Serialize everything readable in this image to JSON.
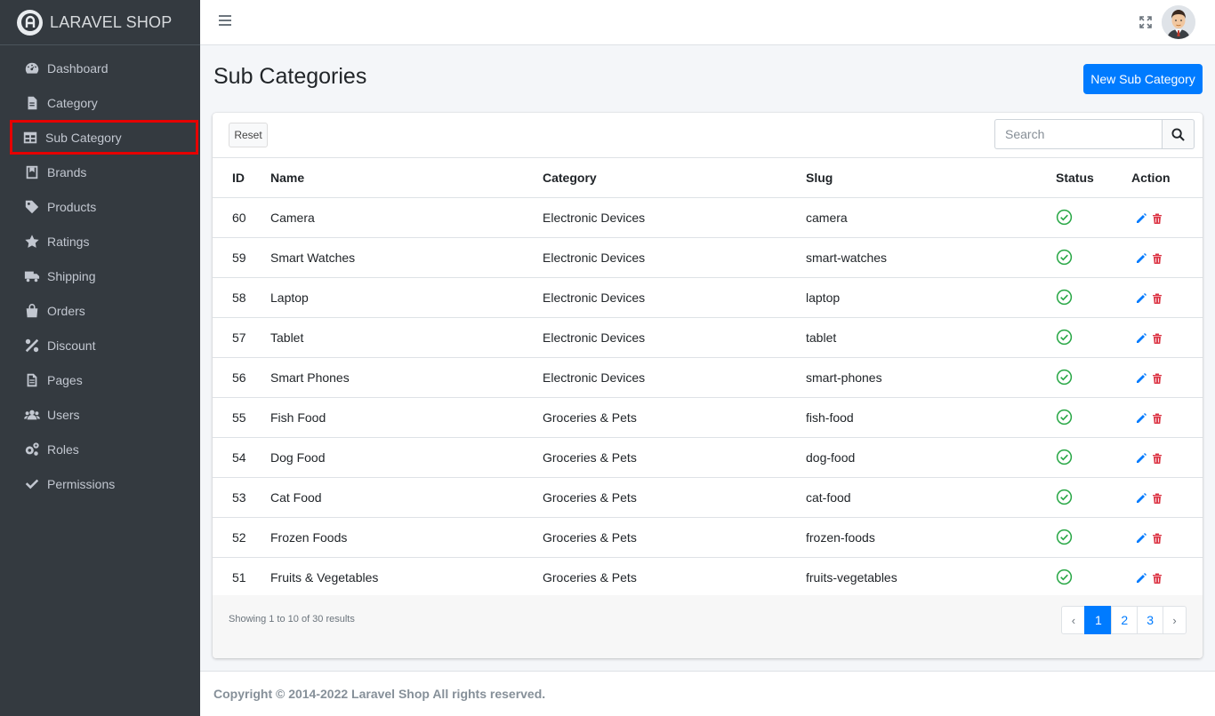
{
  "brand": {
    "name": "LARAVEL SHOP"
  },
  "sidebar": {
    "items": [
      {
        "label": "Dashboard",
        "icon": "tachometer-icon"
      },
      {
        "label": "Category",
        "icon": "file-icon"
      },
      {
        "label": "Sub Category",
        "icon": "table-icon",
        "active": true
      },
      {
        "label": "Brands",
        "icon": "book-icon"
      },
      {
        "label": "Products",
        "icon": "tag-icon"
      },
      {
        "label": "Ratings",
        "icon": "star-icon"
      },
      {
        "label": "Shipping",
        "icon": "truck-icon"
      },
      {
        "label": "Orders",
        "icon": "shopping-bag-icon"
      },
      {
        "label": "Discount",
        "icon": "percent-icon"
      },
      {
        "label": "Pages",
        "icon": "file-text-icon"
      },
      {
        "label": "Users",
        "icon": "users-icon"
      },
      {
        "label": "Roles",
        "icon": "cogs-icon"
      },
      {
        "label": "Permissions",
        "icon": "check-icon"
      }
    ]
  },
  "page": {
    "title": "Sub Categories",
    "new_button": "New Sub Category"
  },
  "toolbar": {
    "reset_label": "Reset",
    "search_placeholder": "Search"
  },
  "table": {
    "headers": {
      "id": "ID",
      "name": "Name",
      "category": "Category",
      "slug": "Slug",
      "status": "Status",
      "action": "Action"
    },
    "rows": [
      {
        "id": "60",
        "name": "Camera",
        "category": "Electronic Devices",
        "slug": "camera",
        "status": "active"
      },
      {
        "id": "59",
        "name": "Smart Watches",
        "category": "Electronic Devices",
        "slug": "smart-watches",
        "status": "active"
      },
      {
        "id": "58",
        "name": "Laptop",
        "category": "Electronic Devices",
        "slug": "laptop",
        "status": "active"
      },
      {
        "id": "57",
        "name": "Tablet",
        "category": "Electronic Devices",
        "slug": "tablet",
        "status": "active"
      },
      {
        "id": "56",
        "name": "Smart Phones",
        "category": "Electronic Devices",
        "slug": "smart-phones",
        "status": "active"
      },
      {
        "id": "55",
        "name": "Fish Food",
        "category": "Groceries & Pets",
        "slug": "fish-food",
        "status": "active"
      },
      {
        "id": "54",
        "name": "Dog Food",
        "category": "Groceries & Pets",
        "slug": "dog-food",
        "status": "active"
      },
      {
        "id": "53",
        "name": "Cat Food",
        "category": "Groceries & Pets",
        "slug": "cat-food",
        "status": "active"
      },
      {
        "id": "52",
        "name": "Frozen Foods",
        "category": "Groceries & Pets",
        "slug": "frozen-foods",
        "status": "active"
      },
      {
        "id": "51",
        "name": "Fruits & Vegetables",
        "category": "Groceries & Pets",
        "slug": "fruits-vegetables",
        "status": "active"
      }
    ]
  },
  "pagination": {
    "summary": "Showing 1 to 10 of 30 results",
    "prev": "‹",
    "next": "›",
    "pages": [
      "1",
      "2",
      "3"
    ],
    "current": "1"
  },
  "footer": {
    "text": "Copyright © 2014-2022 Laravel Shop All rights reserved."
  },
  "colors": {
    "sidebar_bg": "#343a40",
    "primary": "#007bff",
    "success": "#28a745",
    "danger": "#dc3545",
    "highlight": "#e60000"
  }
}
